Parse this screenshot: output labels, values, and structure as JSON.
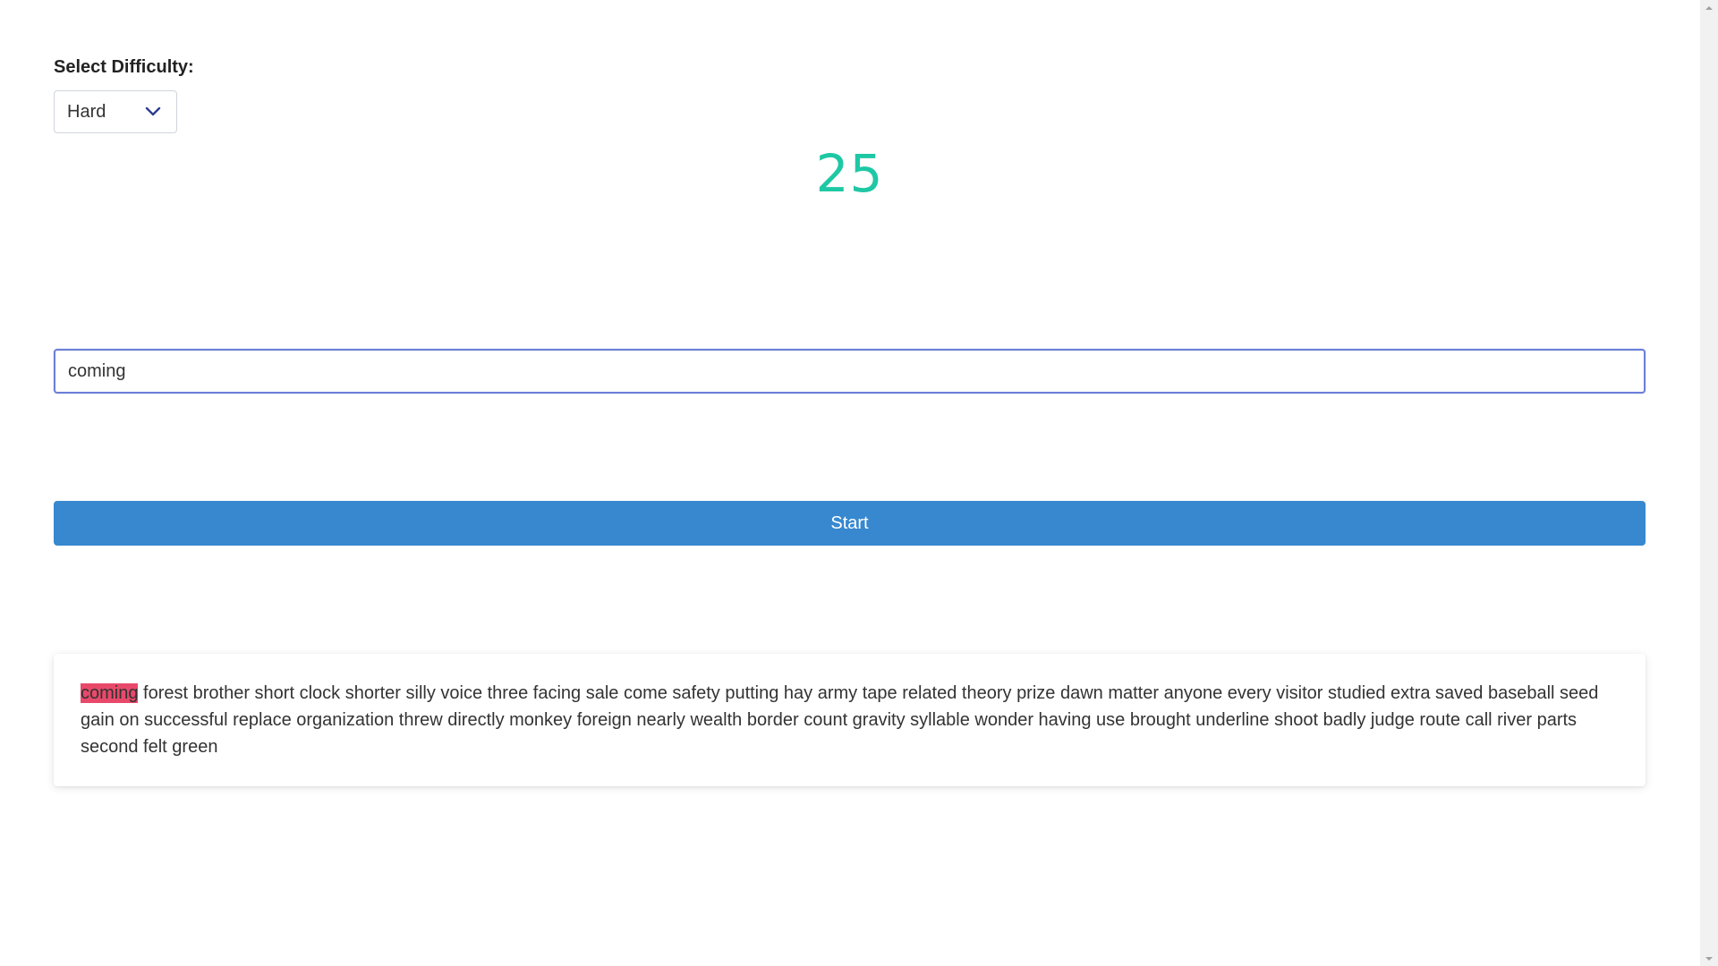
{
  "difficulty": {
    "label": "Select Difficulty:",
    "selected": "Hard",
    "icon": "chevron-down-icon"
  },
  "timer": {
    "value": "25",
    "color": "#1ec8a4"
  },
  "input": {
    "value": "coming"
  },
  "start_button": {
    "label": "Start",
    "color": "#3788cf"
  },
  "words": {
    "current": "coming",
    "current_highlight_color": "#e8496a",
    "rest": "forest brother short clock shorter silly voice three facing sale come safety putting hay army tape related theory prize dawn matter anyone every visitor studied extra saved baseball seed gain on successful replace organization threw directly monkey foreign nearly wealth border count gravity syllable wonder having use brought underline shoot badly judge route call river parts second felt green"
  },
  "scrollbar": {
    "up_icon": "arrow-up-icon",
    "down_icon": "arrow-down-icon"
  }
}
